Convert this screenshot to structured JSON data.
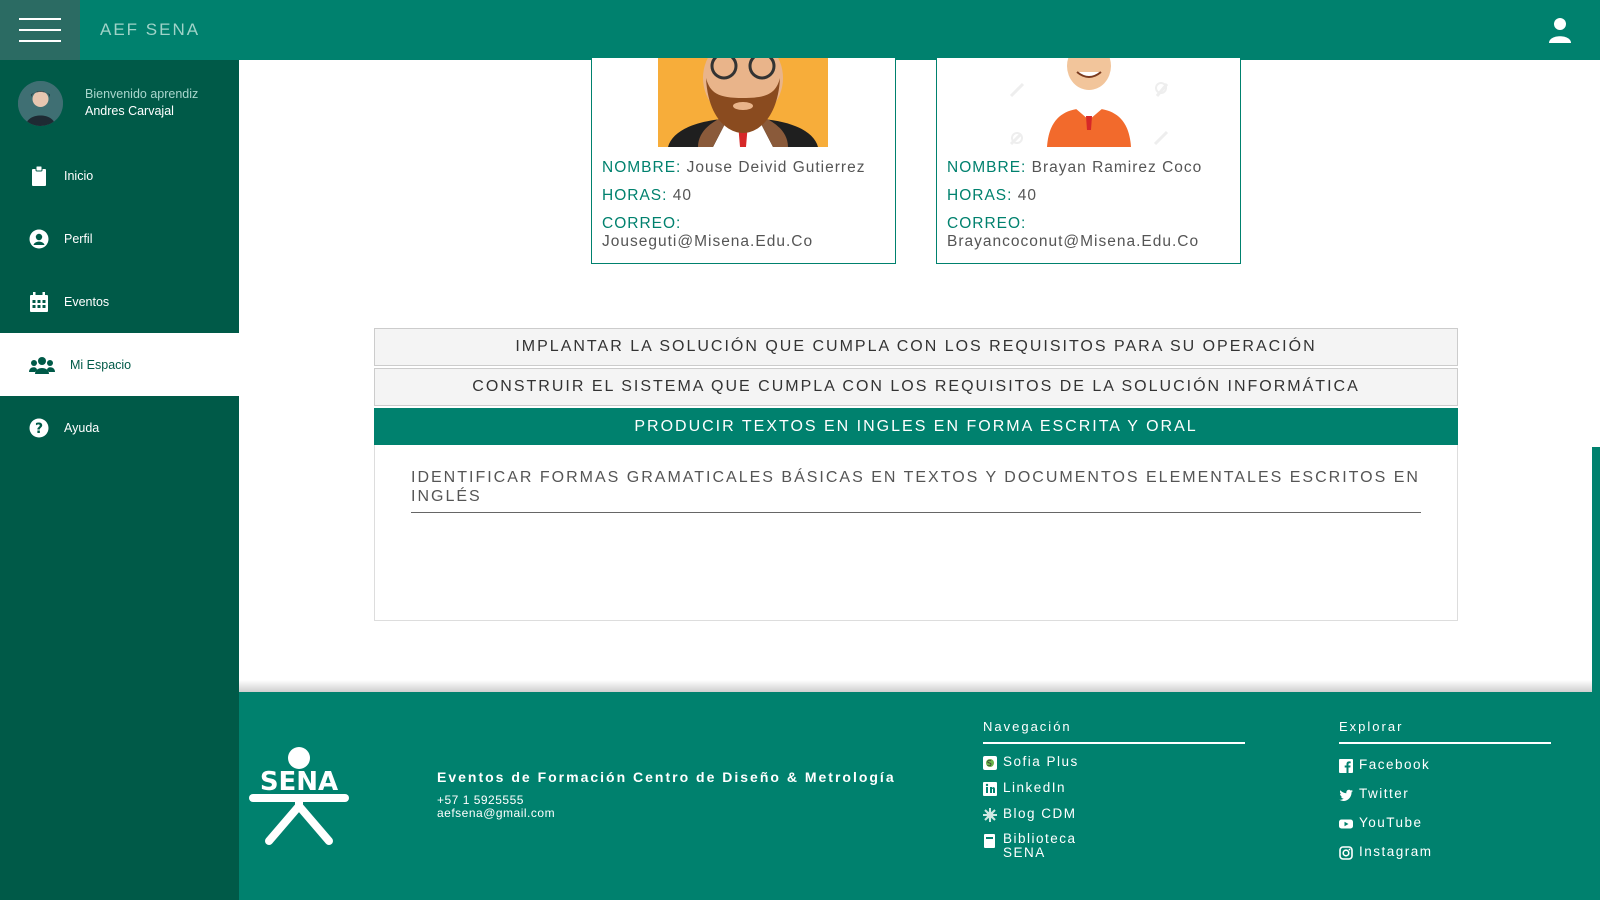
{
  "header": {
    "app_title": "AEF SENA"
  },
  "sidebar": {
    "welcome_sub": "Bienvenido aprendiz",
    "user_name": "Andres Carvajal",
    "items": [
      {
        "label": "Inicio",
        "icon": "clipboard-icon"
      },
      {
        "label": "Perfil",
        "icon": "user-circle-icon"
      },
      {
        "label": "Eventos",
        "icon": "calendar-icon"
      },
      {
        "label": "Mi Espacio",
        "icon": "users-icon",
        "active": true
      },
      {
        "label": "Ayuda",
        "icon": "help-circle-icon"
      }
    ]
  },
  "instructors": [
    {
      "name_label": "NOMBRE:",
      "name": "Jouse Deivid Gutierrez",
      "hours_label": "HORAS:",
      "hours": "40",
      "email_label": "CORREO:",
      "email": "Jouseguti@Misena.Edu.Co"
    },
    {
      "name_label": "NOMBRE:",
      "name": "Brayan Ramirez Coco",
      "hours_label": "HORAS:",
      "hours": "40",
      "email_label": "CORREO:",
      "email": "Brayancoconut@Misena.Edu.Co"
    }
  ],
  "accordion": {
    "sections": [
      {
        "title": "IMPLANTAR LA SOLUCIÓN QUE CUMPLA CON LOS REQUISITOS PARA SU OPERACIÓN"
      },
      {
        "title": "CONSTRUIR EL SISTEMA QUE CUMPLA CON LOS REQUISITOS DE LA SOLUCIÓN INFORMÁTICA"
      },
      {
        "title": "PRODUCIR TEXTOS EN INGLES EN FORMA ESCRITA Y ORAL",
        "expanded": true
      }
    ],
    "expanded_items": [
      "IDENTIFICAR FORMAS GRAMATICALES BÁSICAS EN TEXTOS Y DOCUMENTOS ELEMENTALES ESCRITOS EN INGLÉS"
    ]
  },
  "footer": {
    "title": "Eventos de Formación Centro de Diseño & Metrología",
    "phone": "+57 1 5925555",
    "email": "aefsena@gmail.com",
    "nav_title": "Navegación",
    "nav_links": [
      "Sofia Plus",
      "LinkedIn",
      "Blog CDM",
      "Biblioteca SENA"
    ],
    "explore_title": "Explorar",
    "explore_links": [
      "Facebook",
      "Twitter",
      "YouTube",
      "Instagram"
    ]
  },
  "colors": {
    "primary": "#00816e",
    "sidebar": "#005a48",
    "topbar_menu": "#2b6b63"
  }
}
